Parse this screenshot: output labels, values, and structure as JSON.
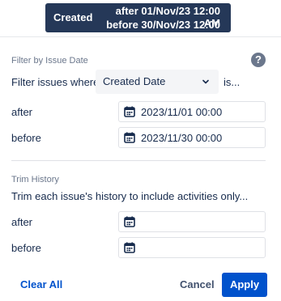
{
  "tooltip": {
    "label": "Created",
    "after_text": "after 01/Nov/23 12:00 AM",
    "before_text": "before 30/Nov/23 12:00 AM"
  },
  "filter_section": {
    "title": "Filter by Issue Date",
    "help_icon": "question-circle-icon",
    "where_label": "Filter issues where",
    "field_select_value": "Created Date",
    "is_label": "is...",
    "after_label": "after",
    "after_value": "2023/11/01 00:00",
    "before_label": "before",
    "before_value": "2023/11/30 00:00"
  },
  "trim_section": {
    "title": "Trim History",
    "description": "Trim each issue's history to include activities only...",
    "after_label": "after",
    "after_value": "",
    "before_label": "before",
    "before_value": ""
  },
  "footer": {
    "clear_all": "Clear All",
    "cancel": "Cancel",
    "apply": "Apply"
  },
  "colors": {
    "tooltip_bg": "#253858",
    "primary": "#0052cc",
    "text": "#172b4d",
    "muted": "#6b778c"
  }
}
